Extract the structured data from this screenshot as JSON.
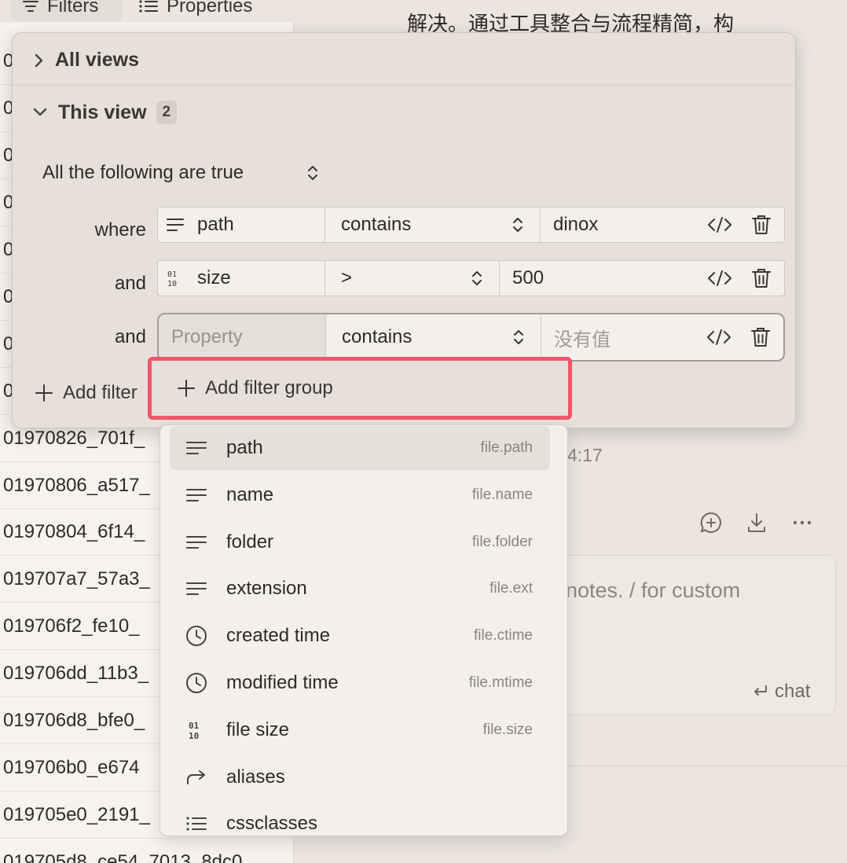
{
  "toolbar": {
    "filters_label": "Filters",
    "properties_label": "Properties"
  },
  "file_list": {
    "rows": [
      {
        "text": "0"
      },
      {
        "text": "0"
      },
      {
        "text": "0"
      },
      {
        "text": "0"
      },
      {
        "text": "0"
      },
      {
        "text": "0"
      },
      {
        "text": "0"
      },
      {
        "text": "0"
      },
      {
        "text": "01970826_701f_"
      },
      {
        "text": "01970806_a517_"
      },
      {
        "text": "01970804_6f14_"
      },
      {
        "text": "019707a7_57a3_"
      },
      {
        "text": "019706f2_fe10_"
      },
      {
        "text": "019706dd_11b3_"
      },
      {
        "text": "019706d8_bfe0_"
      },
      {
        "text": "019706b0_e674"
      },
      {
        "text": "019705e0_2191_"
      },
      {
        "text": "019705d8_ce54_7013_8dc0"
      }
    ]
  },
  "note": {
    "body_snippet": "解决。通过工具整合与流程精简，构",
    "timestamp_fragment": "4:17",
    "chat_placeholder": "notes. / for custom",
    "chat_send_label": "chat"
  },
  "popover": {
    "all_views_label": "All views",
    "this_view_label": "This view",
    "this_view_count": "2",
    "conjunction": "All the following are true",
    "rows": [
      {
        "connector": "where",
        "property": "path",
        "property_icon": "text-lines-icon",
        "operator": "contains",
        "value": ""
      },
      {
        "connector": "and",
        "property": "size",
        "property_icon": "binary-icon",
        "operator": ">",
        "value": ""
      },
      {
        "connector": "and",
        "property": "",
        "property_placeholder": "Property",
        "operator": "contains",
        "value": "",
        "value_placeholder": "没有值"
      }
    ],
    "row_values": [
      "dinox",
      "500"
    ],
    "add_filter_label": "Add filter",
    "add_filter_group_label": "Add filter group",
    "highlight_color": "#f2566a"
  },
  "dropdown": {
    "items": [
      {
        "label": "path",
        "key": "file.path",
        "icon": "text-lines-icon"
      },
      {
        "label": "name",
        "key": "file.name",
        "icon": "text-lines-icon"
      },
      {
        "label": "folder",
        "key": "file.folder",
        "icon": "text-lines-icon"
      },
      {
        "label": "extension",
        "key": "file.ext",
        "icon": "text-lines-icon"
      },
      {
        "label": "created time",
        "key": "file.ctime",
        "icon": "clock-icon"
      },
      {
        "label": "modified time",
        "key": "file.mtime",
        "icon": "clock-icon"
      },
      {
        "label": "file size",
        "key": "file.size",
        "icon": "binary-icon"
      },
      {
        "label": "aliases",
        "key": "",
        "icon": "forward-arrow-icon"
      },
      {
        "label": "cssclasses",
        "key": "",
        "icon": "list-icon"
      }
    ]
  }
}
